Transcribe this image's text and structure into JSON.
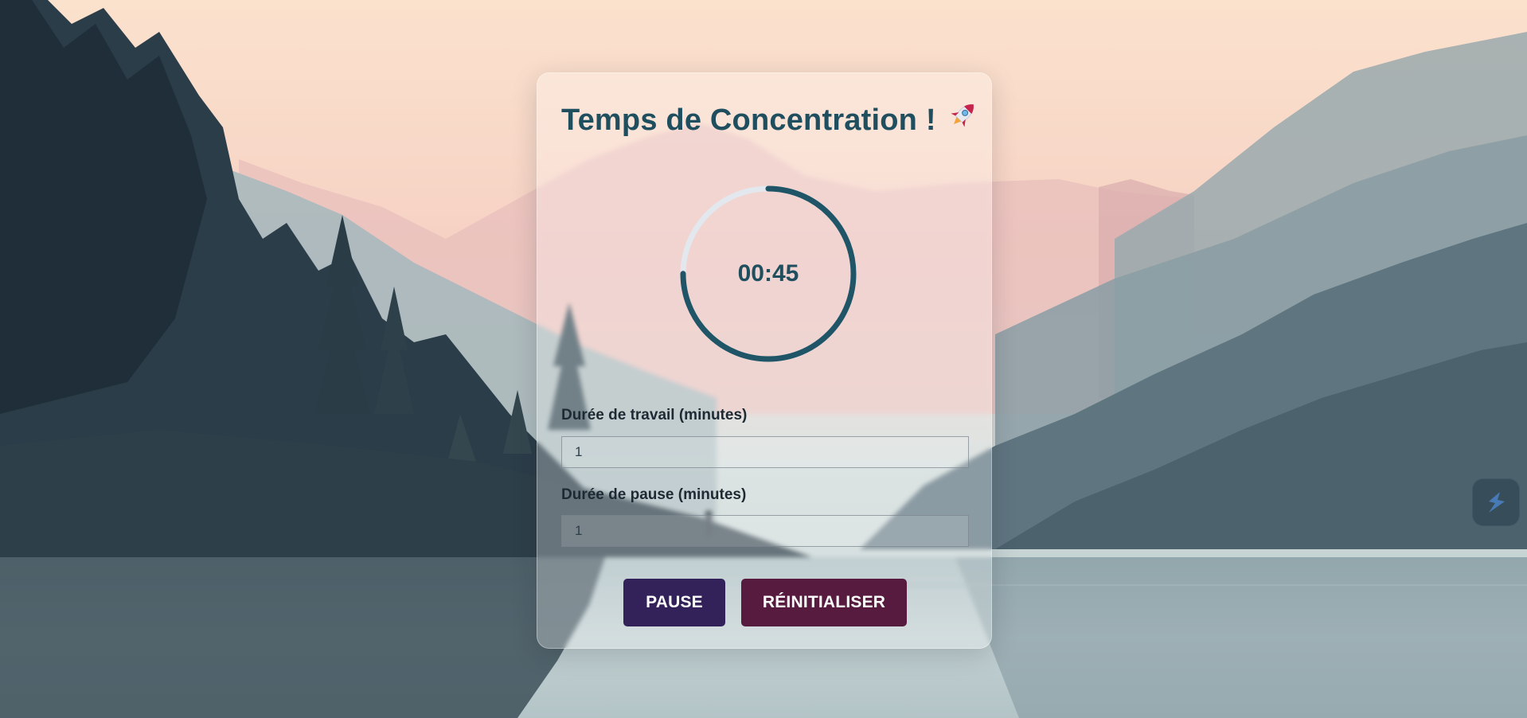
{
  "app": {
    "title": "Temps de Concentration !",
    "title_icon": "rocket-icon"
  },
  "timer": {
    "display": "00:45",
    "progress_fraction": 0.75,
    "ring_color": "#1f5566",
    "track_color": "#e3e7ee"
  },
  "work_duration": {
    "label": "Durée de travail (minutes)",
    "value": "1"
  },
  "break_duration": {
    "label": "Durée de pause (minutes)",
    "value": "1"
  },
  "buttons": {
    "pause_label": "PAUSE",
    "reset_label": "RÉINITIALISER"
  },
  "colors": {
    "title": "#1f4e5f",
    "pause_button": "#33215a",
    "reset_button": "#561b3e"
  },
  "extension": {
    "icon": "sider-extension-icon"
  }
}
